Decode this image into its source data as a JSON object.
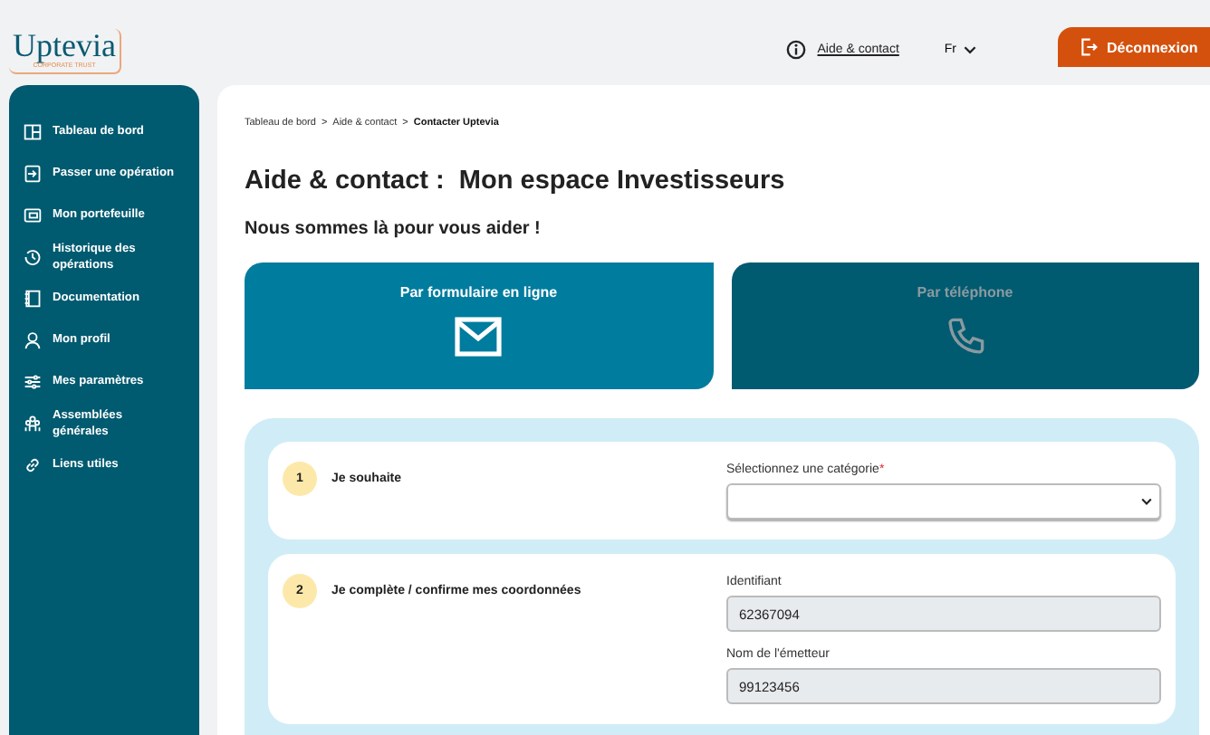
{
  "logo": {
    "name": "Uptevia",
    "tagline": "CORPORATE TRUST"
  },
  "header": {
    "help_link": "Aide & contact",
    "language": "Fr",
    "logout": "Déconnexion"
  },
  "sidebar": {
    "items": [
      {
        "label": "Tableau de bord"
      },
      {
        "label": "Passer une opération"
      },
      {
        "label": "Mon portefeuille"
      },
      {
        "label": "Historique des opérations"
      },
      {
        "label": "Documentation"
      },
      {
        "label": "Mon profil"
      },
      {
        "label": "Mes paramètres"
      },
      {
        "label": "Assemblées générales"
      },
      {
        "label": "Liens utiles"
      }
    ]
  },
  "breadcrumb": [
    {
      "label": "Tableau de bord",
      "current": false
    },
    {
      "label": "Aide & contact",
      "current": false
    },
    {
      "label": "Contacter Uptevia",
      "current": true
    }
  ],
  "breadcrumb_separator": ">",
  "title": "Aide & contact :  Mon espace Investisseurs",
  "subtitle": "Nous sommes là pour vous aider !",
  "tabs": [
    {
      "label": "Par formulaire en ligne",
      "selected": true
    },
    {
      "label": "Par téléphone",
      "selected": false
    }
  ],
  "steps": [
    {
      "number": "1",
      "label": "Je souhaite",
      "fields": [
        {
          "kind": "select",
          "label": "Sélectionnez une catégorie",
          "required": true
        }
      ]
    },
    {
      "number": "2",
      "label": "Je complète / confirme mes coordonnées",
      "fields": [
        {
          "kind": "text",
          "label": "Identifiant",
          "value": "62367094",
          "required": false
        },
        {
          "kind": "text",
          "label": "Nom de l'émetteur",
          "value": "99123456",
          "required": false
        }
      ]
    }
  ],
  "required_mark": "*"
}
